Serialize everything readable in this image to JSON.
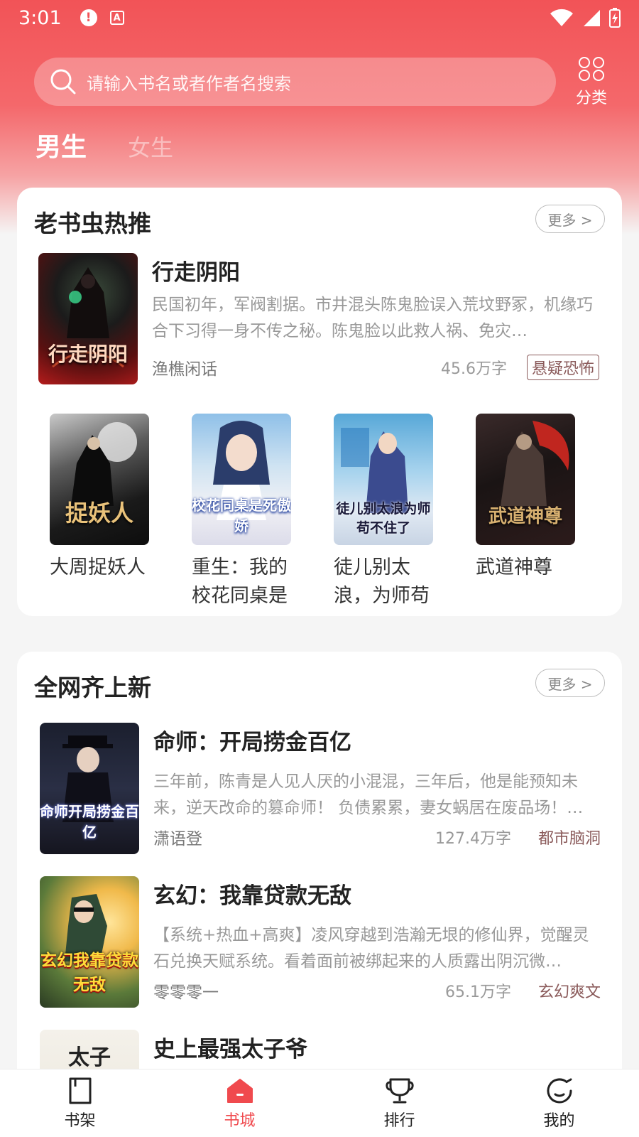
{
  "status_bar": {
    "time": "3:01"
  },
  "search": {
    "placeholder": "请输入书名或者作者名搜索",
    "category_label": "分类"
  },
  "gender_tabs": [
    {
      "label": "男生",
      "active": true
    },
    {
      "label": "女生",
      "active": false
    }
  ],
  "section_hot": {
    "title": "老书虫热推",
    "more_label": "更多 >",
    "featured": {
      "title": "行走阴阳",
      "description": "民国初年，军阀割据。市井混头陈鬼脸误入荒坟野冢，机缘巧合下习得一身不传之秘。陈鬼脸以此救人祸、免灾…",
      "author": "渔樵闲话",
      "words": "45.6万字",
      "tag": "悬疑恐怖",
      "cover_text": "行走阴阳"
    },
    "grid": [
      {
        "title": "大周捉妖人",
        "cover_text": "捉妖人"
      },
      {
        "title": "重生：我的校花同桌是死…",
        "cover_text": "校花同桌是死傲娇"
      },
      {
        "title": "徒儿别太浪，为师苟不住了",
        "cover_text": "徒儿别太浪为师苟不住了"
      },
      {
        "title": "武道神尊",
        "cover_text": "武道神尊"
      }
    ]
  },
  "section_new": {
    "title": "全网齐上新",
    "more_label": "更多 >",
    "books": [
      {
        "title": "命师：开局捞金百亿",
        "description": "三年前，陈青是人见人厌的小混混，三年后，他是能预知未来，逆天改命的篡命师！ 负债累累，妻女蜗居在废品场！…",
        "author": "潇语登",
        "words": "127.4万字",
        "tag": "都市脑洞",
        "cover_text": "命师开局捞金百亿"
      },
      {
        "title": "玄幻：我靠贷款无敌",
        "description": "【系统+热血+高爽】凌风穿越到浩瀚无垠的修仙界，觉醒灵石兑换天赋系统。看着面前被绑起来的人质露出阴沉微…",
        "author": "零零零一",
        "words": "65.1万字",
        "tag": "玄幻爽文",
        "cover_text": "玄幻我靠贷款无敌"
      },
      {
        "title": "史上最强太子爷",
        "cover_text": "太子"
      }
    ]
  },
  "bottom_nav": [
    {
      "label": "书架",
      "icon": "bookshelf-icon",
      "active": false
    },
    {
      "label": "书城",
      "icon": "home-icon",
      "active": true
    },
    {
      "label": "排行",
      "icon": "trophy-icon",
      "active": false
    },
    {
      "label": "我的",
      "icon": "profile-icon",
      "active": false
    }
  ],
  "colors": {
    "accent": "#f04a4e",
    "header": "#f25357",
    "tag": "#8a5a5a"
  }
}
